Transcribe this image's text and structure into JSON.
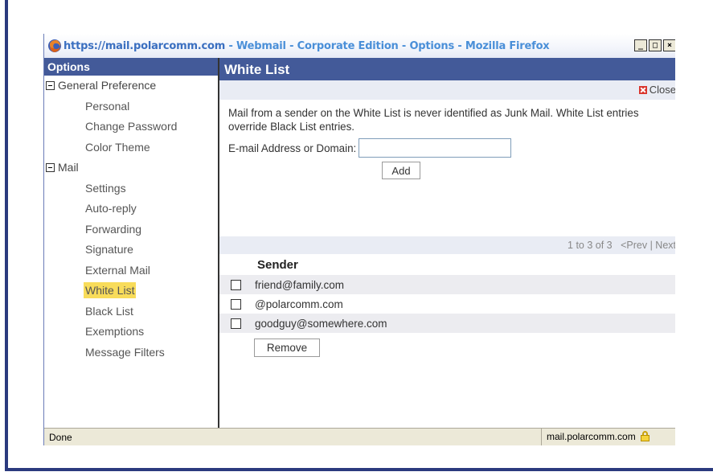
{
  "window": {
    "title_url": "https://mail.polarcomm.com",
    "title_rest": " - Webmail - Corporate Edition - Options - Mozilla Firefox",
    "controls": [
      "_",
      "□",
      "×"
    ]
  },
  "sidebar": {
    "header": "Options",
    "groups": [
      {
        "label": "General Preference",
        "items": [
          "Personal",
          "Change Password",
          "Color Theme"
        ]
      },
      {
        "label": "Mail",
        "items": [
          "Settings",
          "Auto-reply",
          "Forwarding",
          "Signature",
          "External Mail",
          "White List",
          "Black List",
          "Exemptions",
          "Message Filters"
        ]
      }
    ],
    "selected_item": "White List"
  },
  "main": {
    "title": "White List",
    "close_label": "Close",
    "description": "Mail from a sender on the White List is never identified as Junk Mail. White List entries override Black List entries.",
    "email_label": "E-mail Address or Domain:",
    "email_value": "",
    "add_label": "Add",
    "pager": {
      "range": "1 to 3 of 3",
      "prev": "<Prev",
      "separator": "|",
      "next": "Next"
    },
    "sender_header": "Sender",
    "senders": [
      "friend@family.com",
      "@polarcomm.com",
      "goodguy@somewhere.com"
    ],
    "remove_label": "Remove"
  },
  "statusbar": {
    "status": "Done",
    "domain": "mail.polarcomm.com"
  },
  "icons": {
    "app": "firefox-icon",
    "close": "close-x-icon",
    "lock": "lock-icon",
    "tree_toggle": "collapse-minus-icon"
  },
  "colors": {
    "header_bg": "#435a99",
    "selected_bg": "#f8dc5a",
    "frame": "#2b3a7e",
    "title_text": "#4a8fd8"
  }
}
